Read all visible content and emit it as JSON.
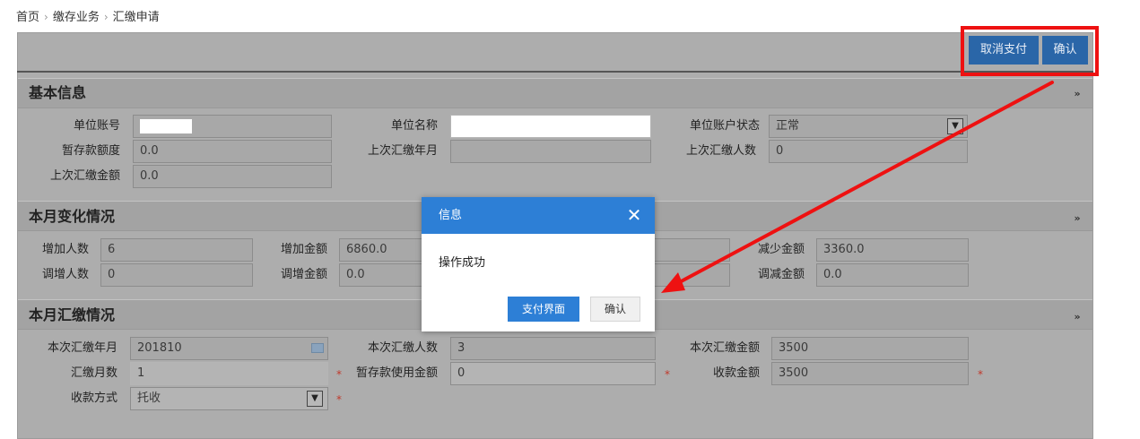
{
  "breadcrumb": {
    "items": [
      "首页",
      "缴存业务",
      "汇缴申请"
    ],
    "separator": "›"
  },
  "toolbar": {
    "cancel_pay_label": "取消支付",
    "confirm_label": "确认"
  },
  "basic_info": {
    "title": "基本信息",
    "fields": {
      "unit_account": {
        "label": "单位账号",
        "value": ""
      },
      "unit_name": {
        "label": "单位名称",
        "value": ""
      },
      "unit_account_status": {
        "label": "单位账户状态",
        "value": "正常"
      },
      "temp_deposit_amount": {
        "label": "暂存款额度",
        "value": "0.0"
      },
      "last_remit_month": {
        "label": "上次汇缴年月",
        "value": ""
      },
      "last_remit_count": {
        "label": "上次汇缴人数",
        "value": "0"
      },
      "last_remit_amount": {
        "label": "上次汇缴金额",
        "value": "0.0"
      }
    }
  },
  "monthly_change": {
    "title": "本月变化情况",
    "fields": {
      "added_count": {
        "label": "增加人数",
        "value": "6"
      },
      "added_amount": {
        "label": "增加金额",
        "value": "6860.0"
      },
      "reduced_amount": {
        "label": "减少金额",
        "value": "3360.0"
      },
      "adjust_up_count": {
        "label": "调增人数",
        "value": "0"
      },
      "adjust_up_amount": {
        "label": "调增金额",
        "value": "0.0"
      },
      "adjust_down_amount": {
        "label": "调减金额",
        "value": "0.0"
      }
    }
  },
  "monthly_remit": {
    "title": "本月汇缴情况",
    "fields": {
      "remit_month": {
        "label": "本次汇缴年月",
        "value": "201810"
      },
      "remit_count": {
        "label": "本次汇缴人数",
        "value": "3"
      },
      "remit_amount": {
        "label": "本次汇缴金额",
        "value": "3500"
      },
      "remit_months": {
        "label": "汇缴月数",
        "value": "1"
      },
      "temp_deposit_used": {
        "label": "暂存款使用金额",
        "value": "0"
      },
      "collect_amount": {
        "label": "收款金额",
        "value": "3500"
      },
      "collect_method": {
        "label": "收款方式",
        "value": "托收"
      }
    },
    "required_mark": "*"
  },
  "dialog": {
    "title": "信息",
    "message": "操作成功",
    "primary_label": "支付界面",
    "secondary_label": "确认"
  },
  "icons": {
    "collapse": "double-chevron-down-icon",
    "close": "close-icon",
    "select": "chevron-down-icon",
    "calendar": "calendar-icon"
  },
  "colors": {
    "accent_blue": "#2d7fd6",
    "toolbar_button": "#2a66a8",
    "annotation_red": "#ee1111",
    "required_red": "#c0392b"
  }
}
